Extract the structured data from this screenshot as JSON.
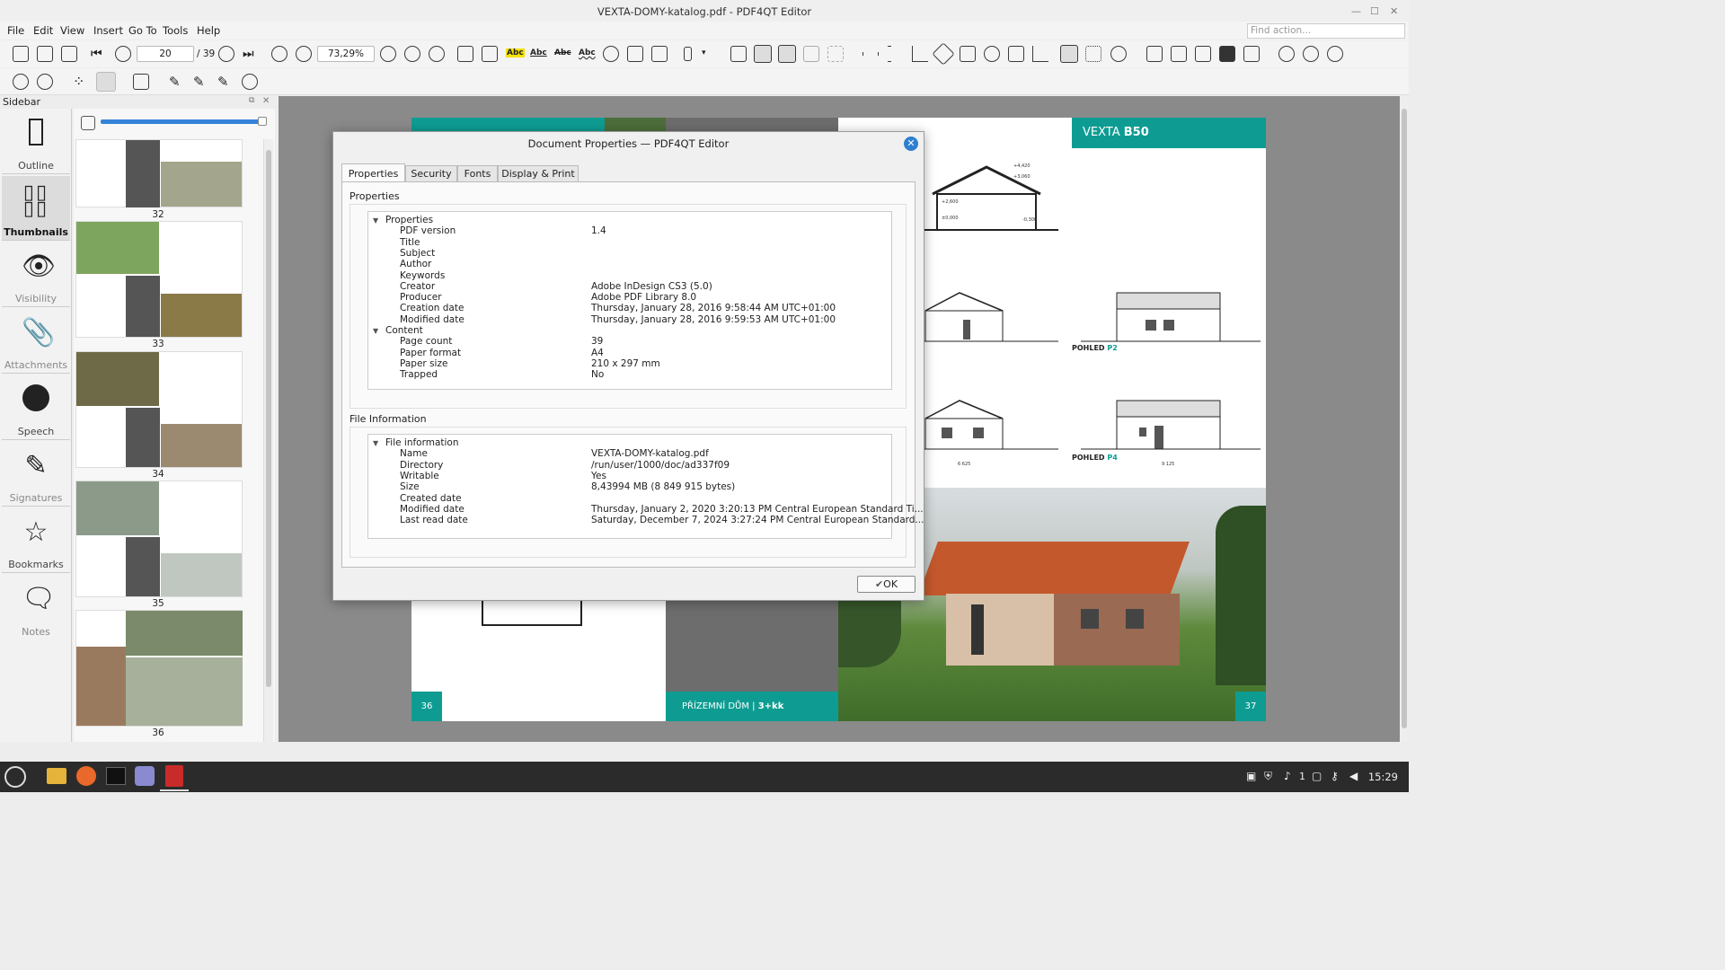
{
  "window": {
    "title": "VEXTA-DOMY-katalog.pdf - PDF4QT Editor"
  },
  "menu": [
    "File",
    "Edit",
    "View",
    "Insert",
    "Go To",
    "Tools",
    "Help"
  ],
  "find_placeholder": "Find action...",
  "toolbar": {
    "page_current": "20",
    "page_total": "/ 39",
    "zoom": "73,29%",
    "abc": "Abc"
  },
  "sidebar": {
    "header": "Sidebar",
    "items": [
      {
        "label": "Outline",
        "icon": "bookmark-outline-icon"
      },
      {
        "label": "Thumbnails",
        "icon": "thumbnails-icon"
      },
      {
        "label": "Visibility",
        "icon": "eye-icon"
      },
      {
        "label": "Attachments",
        "icon": "paperclip-icon"
      },
      {
        "label": "Speech",
        "icon": "speech-icon"
      },
      {
        "label": "Signatures",
        "icon": "pen-icon"
      },
      {
        "label": "Bookmarks",
        "icon": "star-icon"
      },
      {
        "label": "Notes",
        "icon": "note-icon"
      }
    ],
    "thumb_pages": [
      "32",
      "33",
      "34",
      "35",
      "36"
    ]
  },
  "page": {
    "left_num": "36",
    "right_num": "37",
    "brand": "VEXTA",
    "model": "B50",
    "pohled_p2": "POHLED",
    "p2": "P2",
    "p4": "P4",
    "footer_left": "PŘÍZEMNÍ DŮM",
    "footer_right": "3+kk",
    "dim1": "6 625",
    "dim2": "9 125",
    "elev_labels": [
      "+4,420",
      "+3,060",
      "+2,600",
      "±0,000",
      "-0,300"
    ]
  },
  "dialog": {
    "title": "Document Properties — PDF4QT Editor",
    "tabs": [
      "Properties",
      "Security",
      "Fonts",
      "Display & Print"
    ],
    "group1": "Properties",
    "group2": "File Information",
    "props": [
      {
        "k": "Properties",
        "v": "",
        "h": true
      },
      {
        "k": "PDF version",
        "v": "1.4"
      },
      {
        "k": "Title",
        "v": ""
      },
      {
        "k": "Subject",
        "v": ""
      },
      {
        "k": "Author",
        "v": ""
      },
      {
        "k": "Keywords",
        "v": ""
      },
      {
        "k": "Creator",
        "v": "Adobe InDesign CS3 (5.0)"
      },
      {
        "k": "Producer",
        "v": "Adobe PDF Library 8.0"
      },
      {
        "k": "Creation date",
        "v": "Thursday, January 28, 2016 9:58:44 AM UTC+01:00"
      },
      {
        "k": "Modified date",
        "v": "Thursday, January 28, 2016 9:59:53 AM UTC+01:00"
      },
      {
        "k": "Content",
        "v": "",
        "h": true
      },
      {
        "k": "Page count",
        "v": "39"
      },
      {
        "k": "Paper format",
        "v": "A4"
      },
      {
        "k": "Paper size",
        "v": "210 x 297 mm"
      },
      {
        "k": "Trapped",
        "v": "No"
      }
    ],
    "fileinfo": [
      {
        "k": "File information",
        "v": "",
        "h": true
      },
      {
        "k": "Name",
        "v": "VEXTA-DOMY-katalog.pdf"
      },
      {
        "k": "Directory",
        "v": "/run/user/1000/doc/ad337f09"
      },
      {
        "k": "Writable",
        "v": "Yes"
      },
      {
        "k": "Size",
        "v": "8,43994 MB (8 849 915 bytes)"
      },
      {
        "k": "Created date",
        "v": ""
      },
      {
        "k": "Modified date",
        "v": "Thursday, January 2, 2020 3:20:13 PM Central European Standard Ti..."
      },
      {
        "k": "Last read date",
        "v": "Saturday, December 7, 2024 3:27:24 PM Central European Standard..."
      }
    ],
    "ok": "OK"
  },
  "taskbar": {
    "clock": "15:29",
    "ws": "1"
  }
}
